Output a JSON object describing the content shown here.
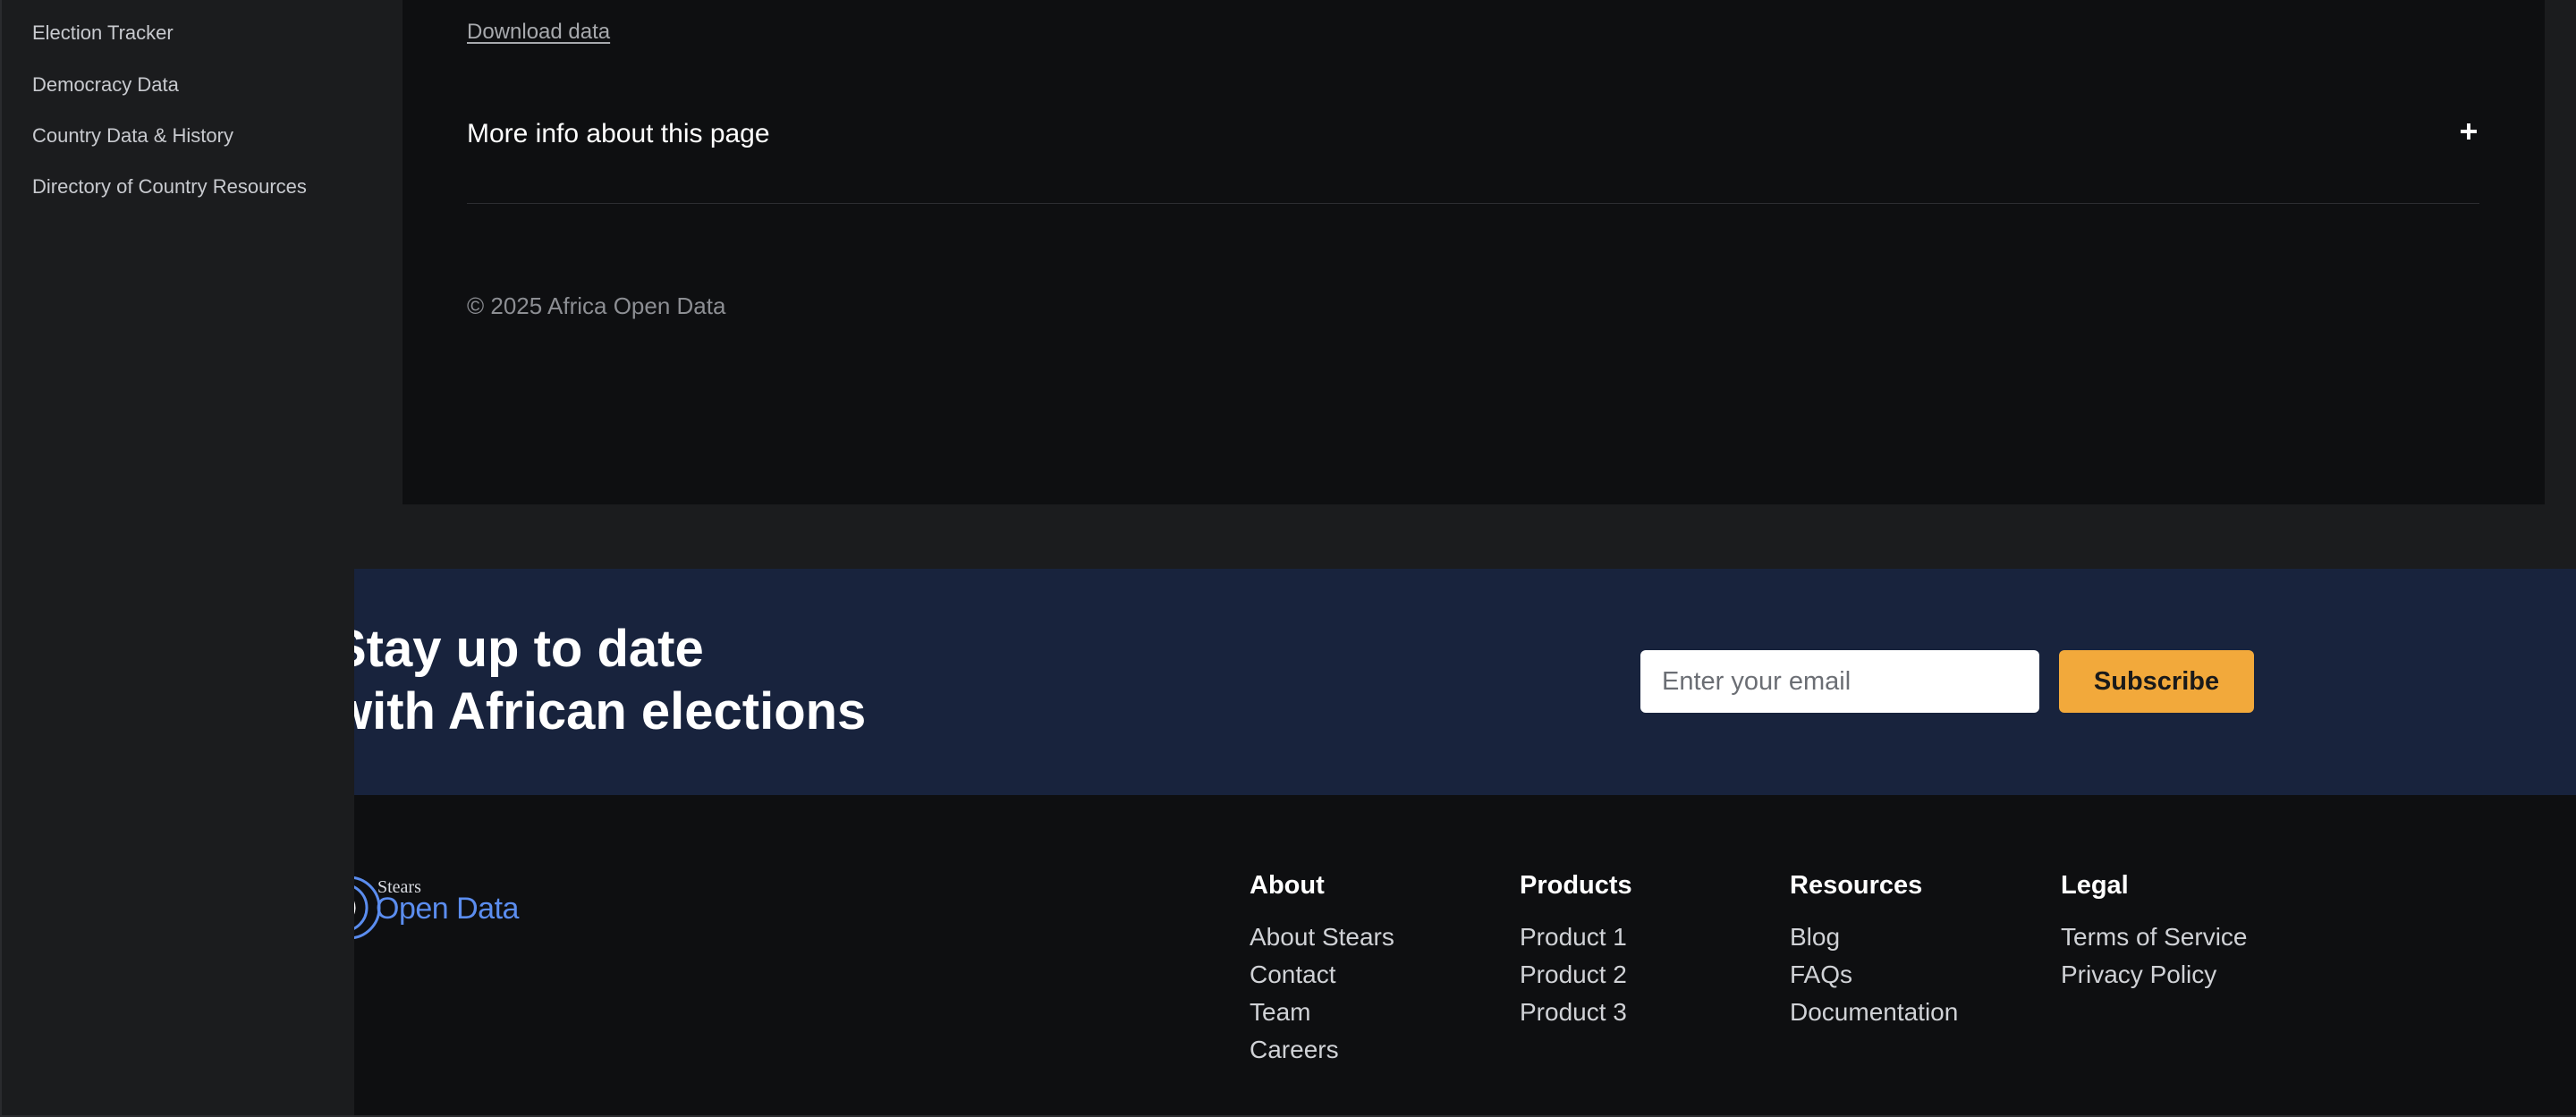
{
  "sidebar": {
    "items": [
      {
        "label": "Election Tracker"
      },
      {
        "label": "Democracy Data"
      },
      {
        "label": "Country Data & History"
      },
      {
        "label": "Directory of Country Resources"
      }
    ]
  },
  "content": {
    "download_label": "Download data",
    "more_info_label": "More info about this page",
    "copyright": "© 2025 Africa Open Data"
  },
  "newsletter": {
    "heading_line1": "Stay up to date",
    "heading_line2": "with African elections",
    "email_placeholder": "Enter your email",
    "subscribe_label": "Subscribe"
  },
  "footer": {
    "logo_small": "Stears",
    "logo_large": "Open Data",
    "columns": [
      {
        "title": "About",
        "links": [
          "About Stears",
          "Contact",
          "Team",
          "Careers"
        ]
      },
      {
        "title": "Products",
        "links": [
          "Product 1",
          "Product 2",
          "Product 3"
        ]
      },
      {
        "title": "Resources",
        "links": [
          "Blog",
          "FAQs",
          "Documentation"
        ]
      },
      {
        "title": "Legal",
        "links": [
          "Terms of Service",
          "Privacy Policy"
        ]
      }
    ]
  },
  "colors": {
    "accent": "#f2a93b",
    "newsletter_bg": "#18233d",
    "logo_blue": "#5b8def"
  }
}
